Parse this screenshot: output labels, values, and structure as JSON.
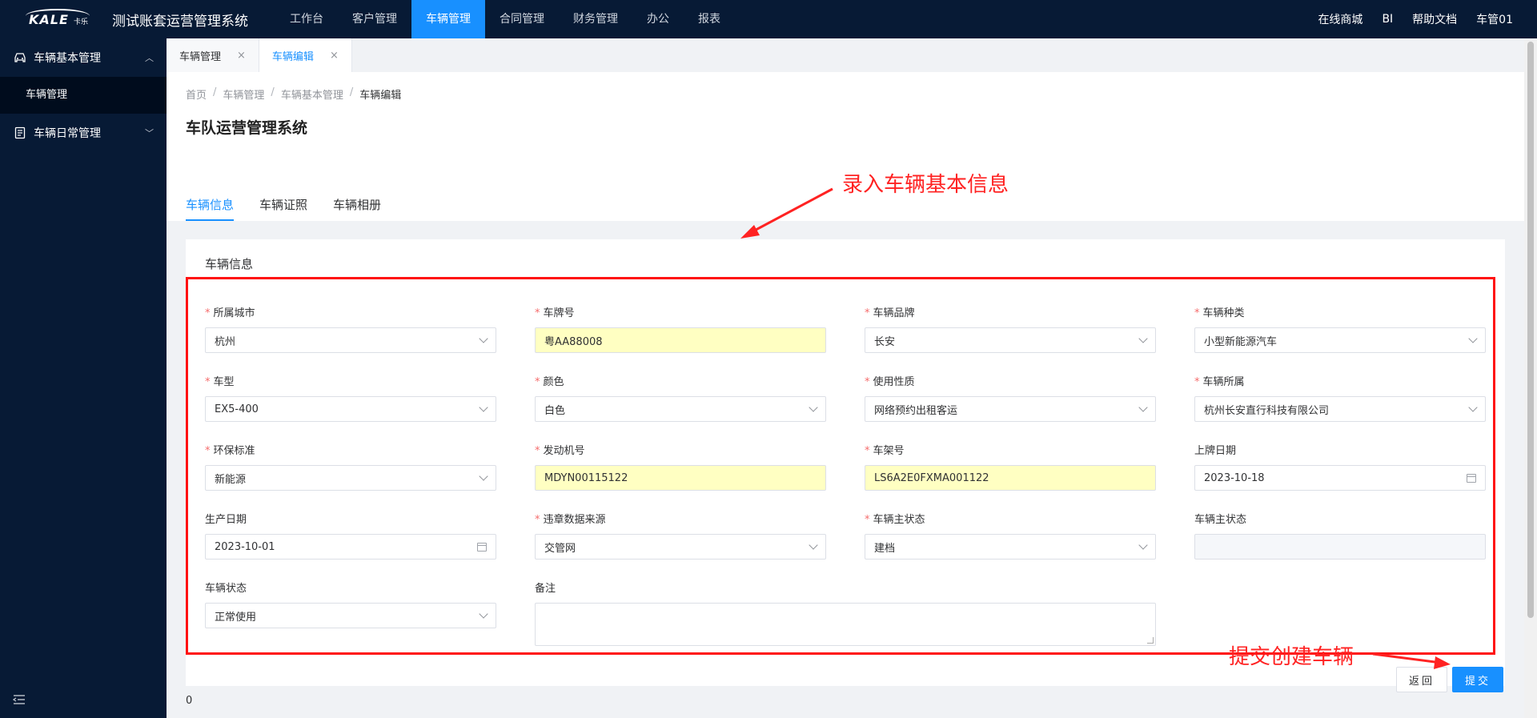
{
  "logo": {
    "text": "KALE",
    "sub": "卡乐"
  },
  "app_title": "测试账套运营管理系统",
  "topnav": [
    "工作台",
    "客户管理",
    "车辆管理",
    "合同管理",
    "财务管理",
    "办公",
    "报表"
  ],
  "topnav_active": 2,
  "top_right": [
    "在线商城",
    "BI",
    "帮助文档",
    "车管01"
  ],
  "sidebar": {
    "group1": {
      "label": "车辆基本管理",
      "arrow": "︿",
      "icon": "car-icon"
    },
    "sub1": "车辆管理",
    "group2": {
      "label": "车辆日常管理",
      "arrow": "﹀",
      "icon": "document-icon"
    }
  },
  "page_tabs": [
    {
      "label": "车辆管理",
      "close": "×"
    },
    {
      "label": "车辆编辑",
      "close": "×"
    }
  ],
  "breadcrumb": [
    "首页",
    "车辆管理",
    "车辆基本管理",
    "车辆编辑"
  ],
  "breadcrumb_sep": "/",
  "page_title": "车队运营管理系统",
  "content_tabs": [
    "车辆信息",
    "车辆证照",
    "车辆相册"
  ],
  "section_title": "车辆信息",
  "fields": {
    "city": {
      "label": "所属城市",
      "value": "杭州",
      "required": "*"
    },
    "plate": {
      "label": "车牌号",
      "value": "粤AA88008",
      "required": "*"
    },
    "brand": {
      "label": "车辆品牌",
      "value": "长安",
      "required": "*"
    },
    "kind": {
      "label": "车辆种类",
      "value": "小型新能源汽车",
      "required": "*"
    },
    "model": {
      "label": "车型",
      "value": "EX5-400",
      "required": "*"
    },
    "color": {
      "label": "颜色",
      "value": "白色",
      "required": "*"
    },
    "usage": {
      "label": "使用性质",
      "value": "网络预约出租客运",
      "required": "*"
    },
    "owner": {
      "label": "车辆所属",
      "value": "杭州长安直行科技有限公司",
      "required": "*"
    },
    "emission": {
      "label": "环保标准",
      "value": "新能源",
      "required": "*"
    },
    "engine": {
      "label": "发动机号",
      "value": "MDYN00115122",
      "required": "*"
    },
    "vin": {
      "label": "车架号",
      "value": "LS6A2E0FXMA001122",
      "required": "*"
    },
    "reg_date": {
      "label": "上牌日期",
      "value": "2023-10-18"
    },
    "prod_date": {
      "label": "生产日期",
      "value": "2023-10-01"
    },
    "violation_src": {
      "label": "违章数据来源",
      "value": "交管网",
      "required": "*"
    },
    "main_status": {
      "label": "车辆主状态",
      "value": "建档",
      "required": "*"
    },
    "main_status2": {
      "label": "车辆主状态",
      "value": ""
    },
    "status": {
      "label": "车辆状态",
      "value": "正常使用"
    },
    "remark": {
      "label": "备注",
      "value": ""
    }
  },
  "footer_value": "0",
  "buttons": {
    "back": "返回",
    "submit": "提交"
  },
  "annotations": {
    "a1": "录入车辆基本信息",
    "a2": "提交创建车辆",
    "color": "#ff2222"
  },
  "colors": {
    "topbar": "#071a35",
    "accent": "#1890ff",
    "highlight": "#ffffc2"
  }
}
